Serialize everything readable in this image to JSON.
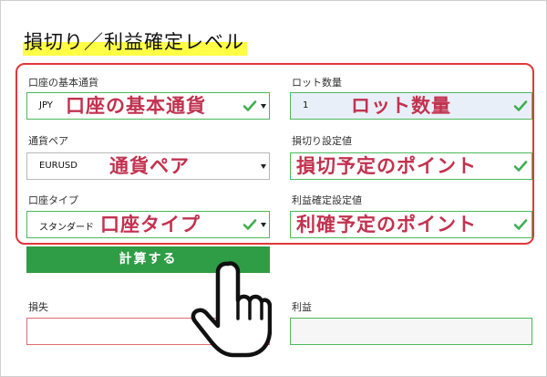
{
  "title": "損切り／利益確定レベル",
  "form": {
    "base_currency": {
      "label": "口座の基本通貨",
      "value": "JPY",
      "annotation": "口座の基本通貨"
    },
    "lot_size": {
      "label": "ロット数量",
      "value": "1",
      "annotation": "ロット数量"
    },
    "currency_pair": {
      "label": "通貨ペア",
      "value": "EURUSD",
      "annotation": "通貨ペア"
    },
    "stop_loss": {
      "label": "損切り設定値",
      "value": "",
      "annotation": "損切予定のポイント"
    },
    "account_type": {
      "label": "口座タイプ",
      "value": "スタンダード",
      "annotation": "口座タイプ"
    },
    "take_profit": {
      "label": "利益確定設定値",
      "value": "",
      "annotation": "利確予定のポイント"
    }
  },
  "calculate_button": "計算する",
  "results": {
    "loss_label": "損失",
    "profit_label": "利益"
  },
  "colors": {
    "highlight": "#ffff45",
    "annotation_box": "#e2363c",
    "annotation_text": "#c2324f",
    "button": "#2f9c46",
    "valid_border": "#4cb85a",
    "error_border": "#e06a70"
  },
  "icons": [
    "check-icon",
    "chevron-down-icon",
    "pointing-hand-icon"
  ]
}
